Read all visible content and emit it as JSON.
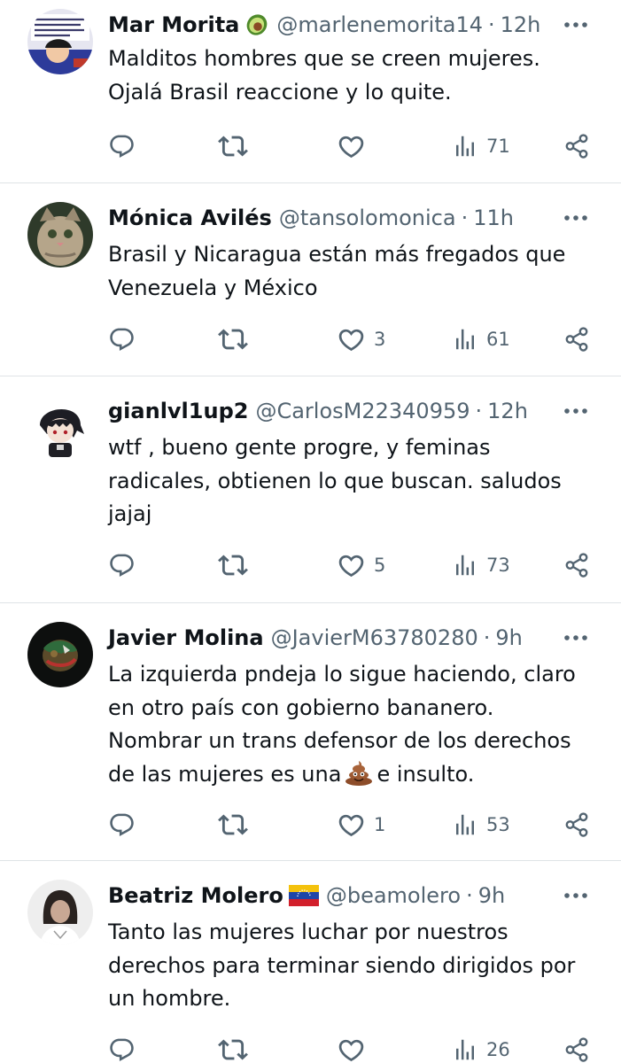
{
  "tweets": [
    {
      "name": "Mar Morita",
      "badge": "avocado-emoji",
      "handle": "@marlenemorita14",
      "dot": "·",
      "time": "12h",
      "lines": [
        "Malditos hombres que se creen mujeres.",
        "Ojalá Brasil reaccione y lo quite."
      ],
      "likes": "",
      "views": "71"
    },
    {
      "name": "Mónica Avilés",
      "badge": "",
      "handle": "@tansolomonica",
      "dot": "·",
      "time": "11h",
      "lines": [
        "Brasil y Nicaragua están más fregados que",
        "Venezuela y México"
      ],
      "likes": "3",
      "views": "61"
    },
    {
      "name": "gianlvl1up2",
      "badge": "",
      "handle": "@CarlosM22340959",
      "dot": "·",
      "time": "12h",
      "lines": [
        "wtf , bueno gente progre, y feminas",
        "radicales, obtienen lo que buscan. saludos",
        "jajaj"
      ],
      "likes": "5",
      "views": "73"
    },
    {
      "name": "Javier Molina",
      "badge": "",
      "handle": "@JavierM63780280",
      "dot": "·",
      "time": "9h",
      "lines": [
        "La izquierda pndeja lo sigue haciendo, claro",
        "en otro país con gobierno bananero.",
        "Nombrar un trans defensor de los derechos"
      ],
      "line4_before": "de las mujeres es una",
      "line4_emoji": "pile-of-poo-emoji",
      "line4_after": "e insulto.",
      "likes": "1",
      "views": "53"
    },
    {
      "name": "Beatriz Molero",
      "badge": "venezuela-flag-emoji",
      "handle": "@beamolero",
      "dot": "·",
      "time": "9h",
      "lines": [
        "Tanto las mujeres luchar por nuestros",
        "derechos para terminar siendo dirigidos por",
        "un hombre."
      ],
      "likes": "",
      "views": "26"
    }
  ],
  "colors": {
    "text": "#0f1419",
    "secondary": "#536471",
    "divider": "#dfe3e6",
    "icon": "#536471"
  }
}
